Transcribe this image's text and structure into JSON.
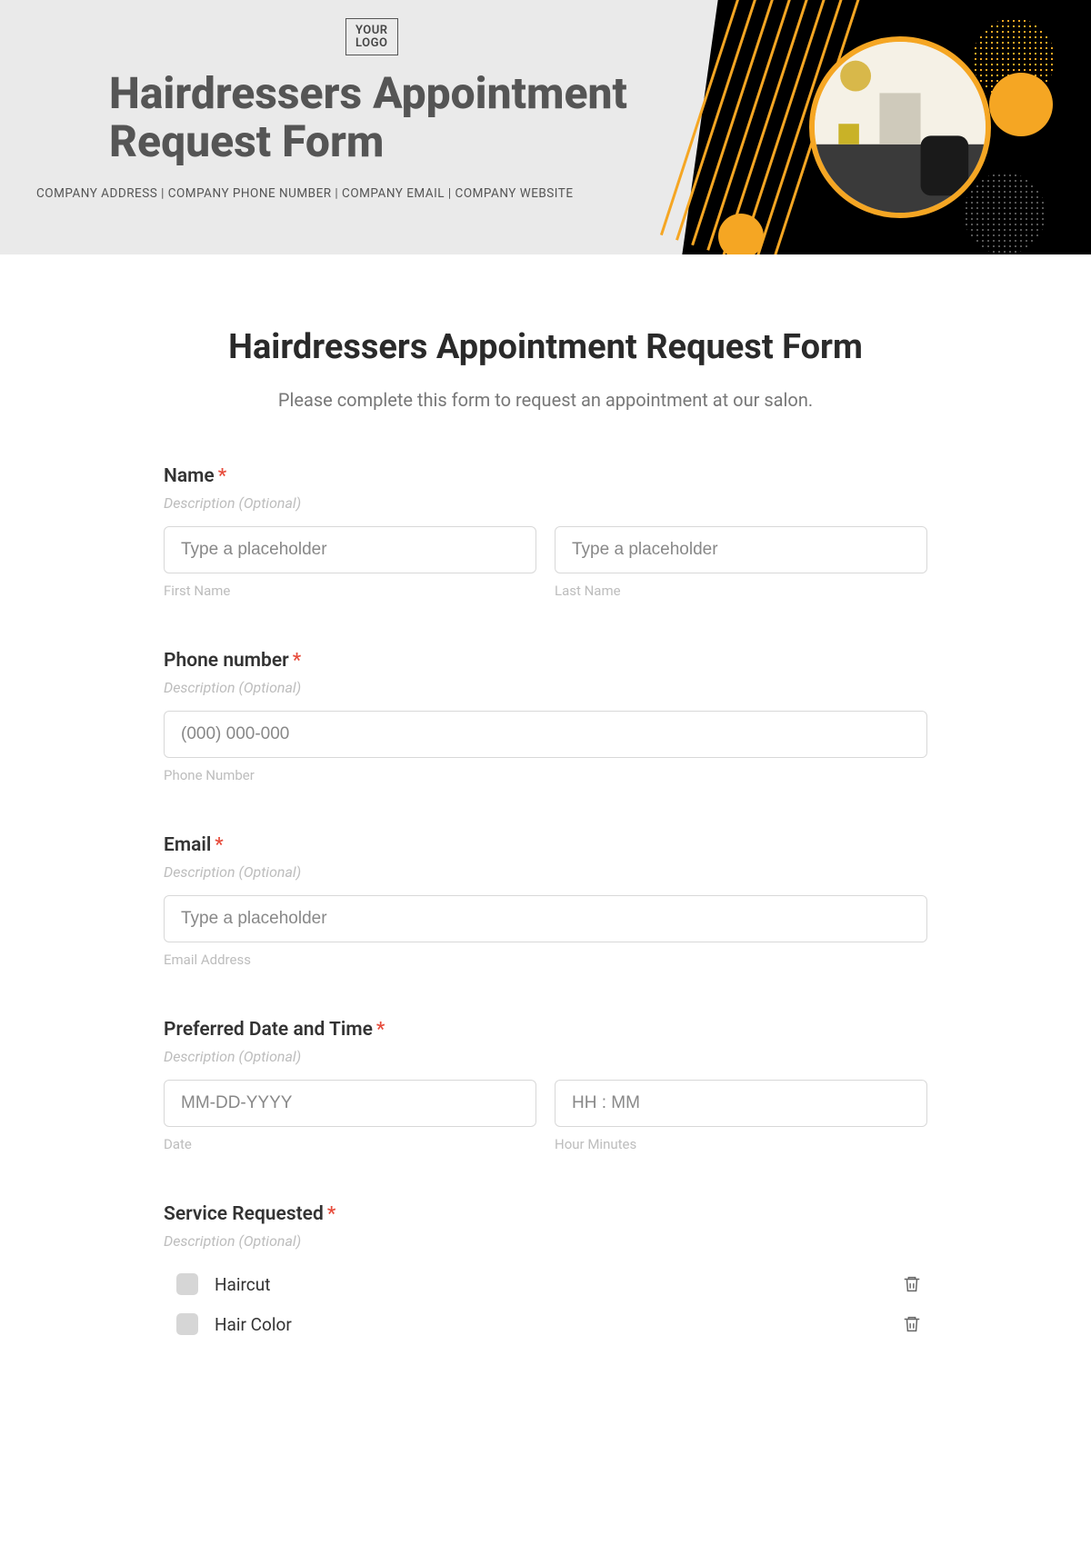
{
  "header": {
    "logo_text": "YOUR\nLOGO",
    "title": "Hairdressers Appointment Request Form",
    "subline": "COMPANY ADDRESS | COMPANY PHONE NUMBER | COMPANY EMAIL | COMPANY WEBSITE"
  },
  "form": {
    "title": "Hairdressers Appointment Request Form",
    "intro": "Please complete this form to request an appointment at our salon.",
    "desc_placeholder": "Description (Optional)",
    "name": {
      "label": "Name",
      "first_placeholder": "Type a placeholder",
      "first_sub": "First Name",
      "last_placeholder": "Type a placeholder",
      "last_sub": "Last Name"
    },
    "phone": {
      "label": "Phone number",
      "placeholder": "(000) 000-000",
      "sub": "Phone Number"
    },
    "email": {
      "label": "Email",
      "placeholder": "Type a placeholder",
      "sub": "Email Address"
    },
    "datetime": {
      "label": "Preferred Date and Time",
      "date_placeholder": "MM-DD-YYYY",
      "date_sub": "Date",
      "time_placeholder": "HH : MM",
      "time_sub": "Hour Minutes"
    },
    "service": {
      "label": "Service Requested",
      "options": [
        "Haircut",
        "Hair Color"
      ]
    }
  }
}
